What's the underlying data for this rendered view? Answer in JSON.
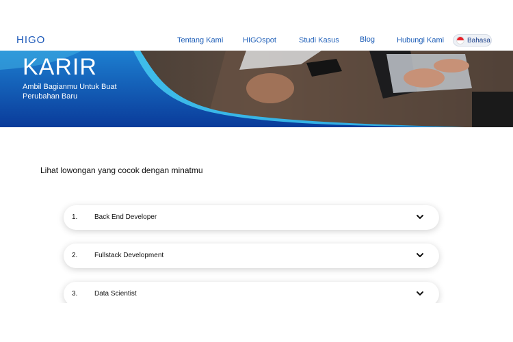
{
  "nav": {
    "logo": "HIGO",
    "links": [
      "Tentang Kami",
      "HIGOspot",
      "Studi Kasus",
      "Blog",
      "Hubungi Kami"
    ],
    "language_label": "Bahasa"
  },
  "hero": {
    "title": "KARIR",
    "subtitle": "Ambil Bagianmu Untuk Buat Perubahan Baru"
  },
  "jobs_section": {
    "title": "Lihat lowongan yang cocok dengan minatmu",
    "items": [
      {
        "number": "1.",
        "name": "Back End Developer"
      },
      {
        "number": "2.",
        "name": "Fullstack Development"
      },
      {
        "number": "3.",
        "name": "Data Scientist"
      }
    ]
  },
  "colors": {
    "brand_blue": "#1a57b8",
    "hero_deep_blue": "#0a3b9a",
    "hero_light_blue": "#35b8e6"
  },
  "icons": {
    "flag": "indonesia-flag-icon",
    "expand": "chevron-down-icon"
  }
}
